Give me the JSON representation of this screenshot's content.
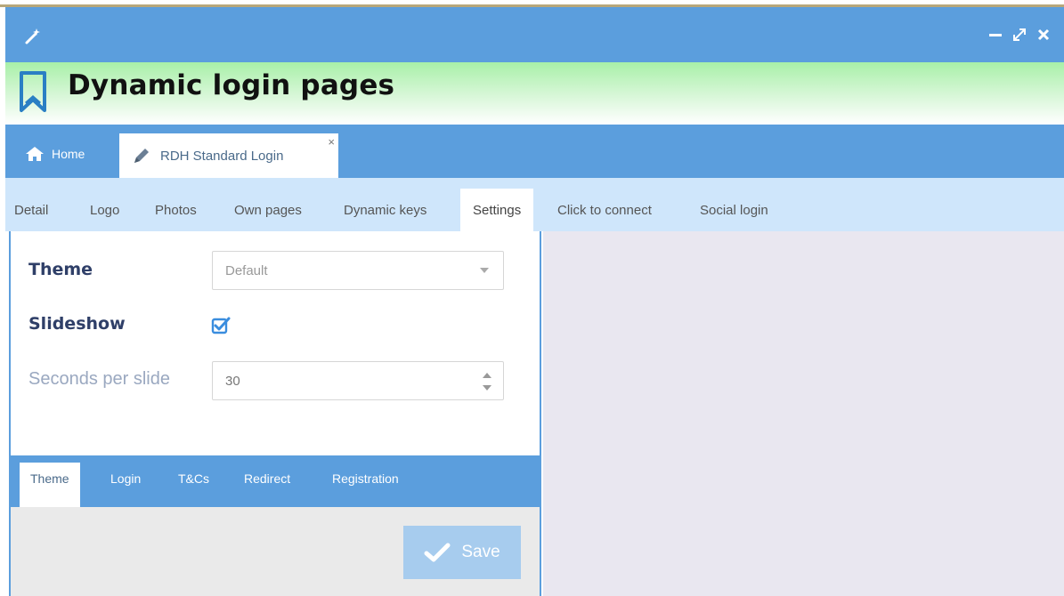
{
  "window": {
    "title": "Dynamic login pages",
    "bar_color": "#5b9edd"
  },
  "tabs": {
    "home_label": "Home",
    "document_label": "RDH Standard Login",
    "close_glyph": "×"
  },
  "subtabs": [
    "Detail",
    "Logo",
    "Photos",
    "Own pages",
    "Dynamic keys",
    "Settings",
    "Click to connect",
    "Social login"
  ],
  "active_subtab": "Settings",
  "form": {
    "theme_label": "Theme",
    "theme_value": "Default",
    "slideshow_label": "Slideshow",
    "slideshow_checked": true,
    "seconds_label": "Seconds per slide",
    "seconds_value": "30"
  },
  "bottom_tabs": [
    "Theme",
    "Login",
    "T&Cs",
    "Redirect",
    "Registration"
  ],
  "active_bottom_tab": "Theme",
  "footer": {
    "save_label": "Save"
  },
  "icons": {
    "wand": "wand-icon",
    "bookmark": "bookmark-icon",
    "home": "home-icon",
    "pencil": "pencil-icon",
    "check": "check-icon"
  }
}
